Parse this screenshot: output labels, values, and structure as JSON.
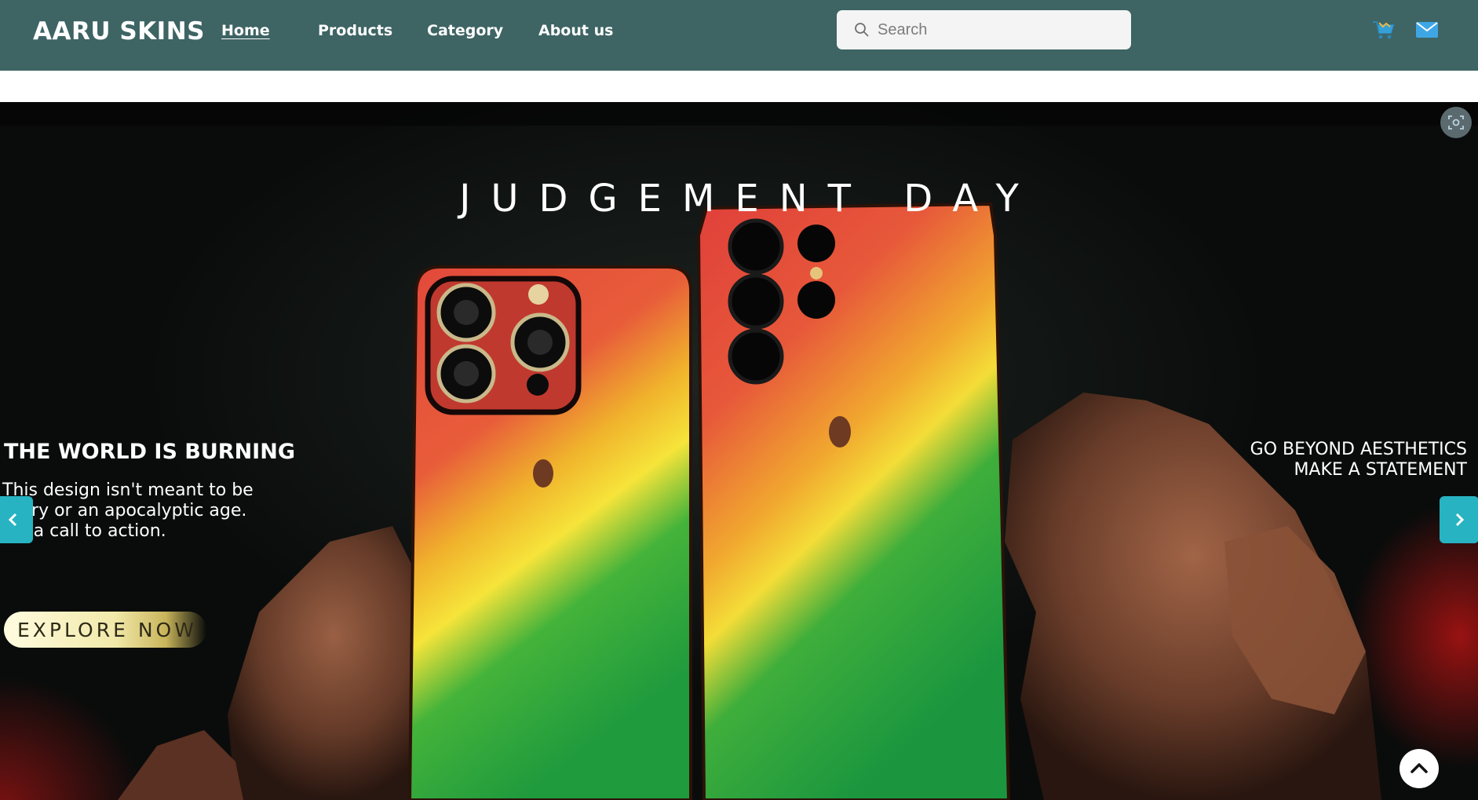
{
  "navbar": {
    "brand": "AARU SKINS",
    "links": [
      {
        "label": "Home",
        "active": true
      },
      {
        "label": "Products",
        "active": false
      },
      {
        "label": "Category",
        "active": false
      },
      {
        "label": "About us",
        "active": false
      }
    ],
    "search": {
      "placeholder": "Search",
      "value": "",
      "icon": "search-icon"
    },
    "icons": [
      "cart-icon",
      "mail-icon"
    ]
  },
  "hero": {
    "title": "JUDGEMENT DAY",
    "left_heading": "THE WORLD IS BURNING",
    "left_body": "This design isn't meant to be scary or an apocalyptic age. It's a call to action.",
    "cta_label": "EXPLORE NOW",
    "right_line1": "GO BEYOND AESTHETICS",
    "right_line2": "MAKE A STATEMENT",
    "colors": {
      "accent_arrow": "#27b3c2",
      "nav_bg": "#3e6464"
    },
    "controls": [
      "prev-arrow",
      "next-arrow",
      "lens-icon",
      "scroll-to-top"
    ]
  }
}
